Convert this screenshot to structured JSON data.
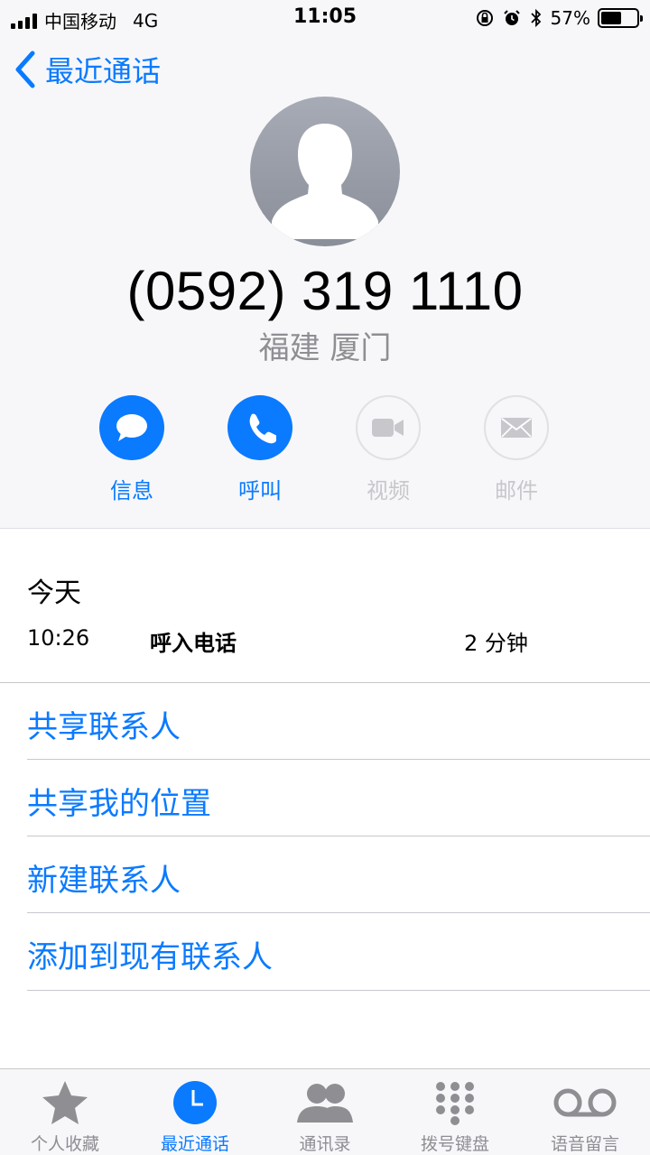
{
  "status_bar": {
    "carrier": "中国移动",
    "network": "4G",
    "time": "11:05",
    "battery": "57%",
    "battery_level": 0.57
  },
  "nav": {
    "back_label": "最近通话"
  },
  "contact": {
    "phone_number": "(0592) 319 1110",
    "location": "福建 厦门"
  },
  "actions": [
    {
      "label": "信息",
      "icon": "message-icon",
      "enabled": true
    },
    {
      "label": "呼叫",
      "icon": "phone-icon",
      "enabled": true
    },
    {
      "label": "视频",
      "icon": "video-icon",
      "enabled": false
    },
    {
      "label": "邮件",
      "icon": "mail-icon",
      "enabled": false
    }
  ],
  "history": {
    "date": "今天",
    "entries": [
      {
        "time": "10:26",
        "type": "呼入电话",
        "duration": "2 分钟"
      }
    ]
  },
  "options": [
    "共享联系人",
    "共享我的位置",
    "新建联系人",
    "添加到现有联系人"
  ],
  "tabs": [
    {
      "label": "个人收藏",
      "icon": "star-icon",
      "active": false
    },
    {
      "label": "最近通话",
      "icon": "clock-icon",
      "active": true
    },
    {
      "label": "通讯录",
      "icon": "contacts-icon",
      "active": false
    },
    {
      "label": "拨号键盘",
      "icon": "keypad-icon",
      "active": false
    },
    {
      "label": "语音留言",
      "icon": "voicemail-icon",
      "active": false
    }
  ],
  "colors": {
    "accent": "#0a7aff",
    "disabled": "#c7c7cc",
    "secondary_text": "#8e8e93"
  }
}
